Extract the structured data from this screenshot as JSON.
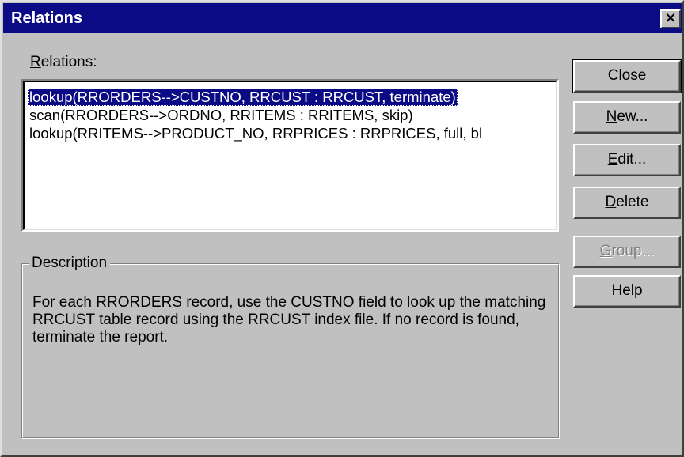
{
  "window": {
    "title": "Relations",
    "close_glyph": "×"
  },
  "relations": {
    "label_prefix": "",
    "label_accel": "R",
    "label_rest": "elations:",
    "items": [
      "lookup(RRORDERS-->CUSTNO, RRCUST : RRCUST, terminate)",
      "scan(RRORDERS-->ORDNO, RRITEMS : RRITEMS, skip)",
      "lookup(RRITEMS-->PRODUCT_NO, RRPRICES : RRPRICES, full, bl"
    ],
    "selected_index": 0
  },
  "description": {
    "legend": "Description",
    "text": "For each RRORDERS record, use the CUSTNO field to look up the matching RRCUST table record using the RRCUST index file. If no record is found, terminate the report."
  },
  "buttons": {
    "close": {
      "accel": "C",
      "rest": "lose"
    },
    "new": {
      "accel": "N",
      "rest": "ew..."
    },
    "edit": {
      "accel": "E",
      "rest": "dit..."
    },
    "delete": {
      "accel": "D",
      "rest": "elete"
    },
    "group": {
      "accel": "G",
      "rest": "roup..."
    },
    "help": {
      "accel": "H",
      "rest": "elp"
    }
  },
  "colors": {
    "titlebar": "#0b0b85",
    "face": "#c0c0c0",
    "selection": "#0b0b85"
  }
}
